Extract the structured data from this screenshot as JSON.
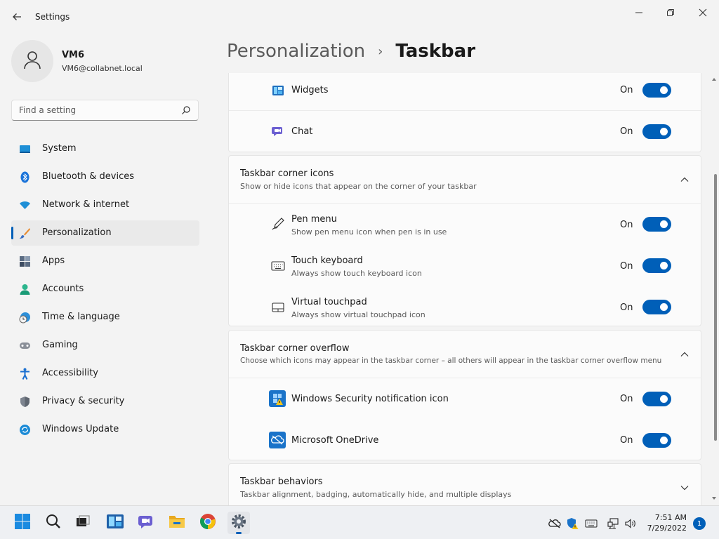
{
  "window": {
    "title": "Settings",
    "back_icon": "back-arrow-icon",
    "minimize_icon": "minimize-icon",
    "maximize_icon": "restore-icon",
    "close_icon": "close-icon"
  },
  "user": {
    "name": "VM6",
    "email": "VM6@collabnet.local",
    "avatar_icon": "person-icon"
  },
  "search": {
    "placeholder": "Find a setting",
    "value": "",
    "icon": "search-icon"
  },
  "nav": {
    "items": [
      {
        "label": "System",
        "icon": "system-icon",
        "selected": false
      },
      {
        "label": "Bluetooth & devices",
        "icon": "bluetooth-icon",
        "selected": false
      },
      {
        "label": "Network & internet",
        "icon": "wifi-icon",
        "selected": false
      },
      {
        "label": "Personalization",
        "icon": "brush-icon",
        "selected": true
      },
      {
        "label": "Apps",
        "icon": "apps-icon",
        "selected": false
      },
      {
        "label": "Accounts",
        "icon": "accounts-icon",
        "selected": false
      },
      {
        "label": "Time & language",
        "icon": "clock-globe-icon",
        "selected": false
      },
      {
        "label": "Gaming",
        "icon": "gamepad-icon",
        "selected": false
      },
      {
        "label": "Accessibility",
        "icon": "accessibility-icon",
        "selected": false
      },
      {
        "label": "Privacy & security",
        "icon": "shield-icon",
        "selected": false
      },
      {
        "label": "Windows Update",
        "icon": "update-icon",
        "selected": false
      }
    ]
  },
  "breadcrumb": {
    "parent": "Personalization",
    "separator": "›",
    "current": "Taskbar"
  },
  "taskbar_items_card": {
    "rows": [
      {
        "title": "Widgets",
        "icon": "widgets-icon",
        "state": "On",
        "enabled": true
      },
      {
        "title": "Chat",
        "icon": "chat-icon",
        "state": "On",
        "enabled": true
      }
    ]
  },
  "corner_icons": {
    "title": "Taskbar corner icons",
    "subtitle": "Show or hide icons that appear on the corner of your taskbar",
    "expanded": true,
    "rows": [
      {
        "title": "Pen menu",
        "subtitle": "Show pen menu icon when pen is in use",
        "icon": "pen-icon",
        "state": "On",
        "enabled": true
      },
      {
        "title": "Touch keyboard",
        "subtitle": "Always show touch keyboard icon",
        "icon": "keyboard-icon",
        "state": "On",
        "enabled": true
      },
      {
        "title": "Virtual touchpad",
        "subtitle": "Always show virtual touchpad icon",
        "icon": "touchpad-icon",
        "state": "On",
        "enabled": true
      }
    ]
  },
  "corner_overflow": {
    "title": "Taskbar corner overflow",
    "subtitle": "Choose which icons may appear in the taskbar corner – all others will appear in the taskbar corner overflow menu",
    "expanded": true,
    "rows": [
      {
        "title": "Windows Security notification icon",
        "icon": "windows-security-icon",
        "state": "On",
        "enabled": true
      },
      {
        "title": "Microsoft OneDrive",
        "icon": "onedrive-icon",
        "state": "On",
        "enabled": true
      }
    ]
  },
  "behaviors": {
    "title": "Taskbar behaviors",
    "subtitle": "Taskbar alignment, badging, automatically hide, and multiple displays",
    "expanded": false
  },
  "taskbar": {
    "apps": [
      {
        "name": "start",
        "icon": "windows-start-icon"
      },
      {
        "name": "search",
        "icon": "search-icon"
      },
      {
        "name": "task-view",
        "icon": "task-view-icon"
      },
      {
        "name": "widgets",
        "icon": "widgets-icon"
      },
      {
        "name": "chat",
        "icon": "teams-chat-icon"
      },
      {
        "name": "file-explorer",
        "icon": "folder-icon"
      },
      {
        "name": "chrome",
        "icon": "chrome-icon"
      },
      {
        "name": "settings",
        "icon": "gear-icon",
        "active": true
      }
    ],
    "tray": [
      {
        "name": "onedrive",
        "icon": "onedrive-offline-icon"
      },
      {
        "name": "security",
        "icon": "windows-security-warning-icon"
      },
      {
        "name": "keyboard",
        "icon": "keyboard-icon"
      },
      {
        "name": "network",
        "icon": "network-icon"
      },
      {
        "name": "volume",
        "icon": "volume-icon"
      }
    ],
    "time": "7:51 AM",
    "date": "7/29/2022",
    "notification_count": "1"
  },
  "colors": {
    "accent": "#005fb8",
    "background": "#f3f3f3",
    "card": "#fbfbfb"
  }
}
